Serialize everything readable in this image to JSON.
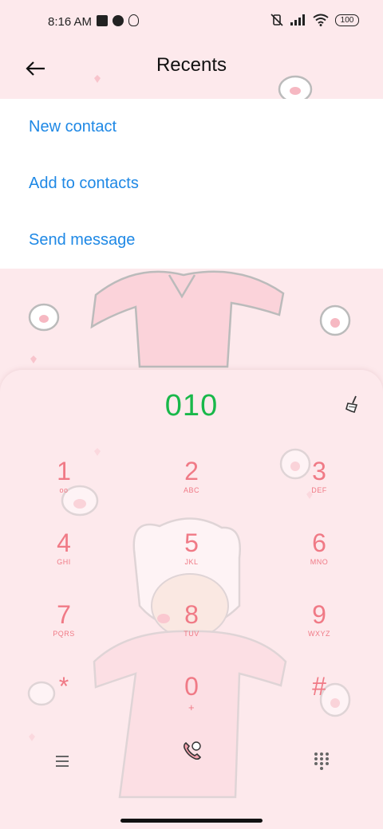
{
  "status_bar": {
    "time": "8:16 AM",
    "battery": "100"
  },
  "header": {
    "title": "Recents",
    "back_icon": "arrow-left-icon"
  },
  "menu": {
    "items": [
      {
        "label": "New contact"
      },
      {
        "label": "Add to contacts"
      },
      {
        "label": "Send message"
      }
    ]
  },
  "dialer": {
    "number": "010",
    "keys": [
      {
        "digit": "1",
        "letters": ""
      },
      {
        "digit": "2",
        "letters": "ABC"
      },
      {
        "digit": "3",
        "letters": "DEF"
      },
      {
        "digit": "4",
        "letters": "GHI"
      },
      {
        "digit": "5",
        "letters": "JKL"
      },
      {
        "digit": "6",
        "letters": "MNO"
      },
      {
        "digit": "7",
        "letters": "PQRS"
      },
      {
        "digit": "8",
        "letters": "TUV"
      },
      {
        "digit": "9",
        "letters": "WXYZ"
      },
      {
        "digit": "*",
        "letters": ""
      },
      {
        "digit": "0",
        "letters": "+"
      },
      {
        "digit": "#",
        "letters": ""
      }
    ]
  },
  "colors": {
    "background": "#fde9ec",
    "accent_blue": "#1e88e5",
    "number_green": "#19b84a",
    "key_pink": "#f07a86"
  }
}
